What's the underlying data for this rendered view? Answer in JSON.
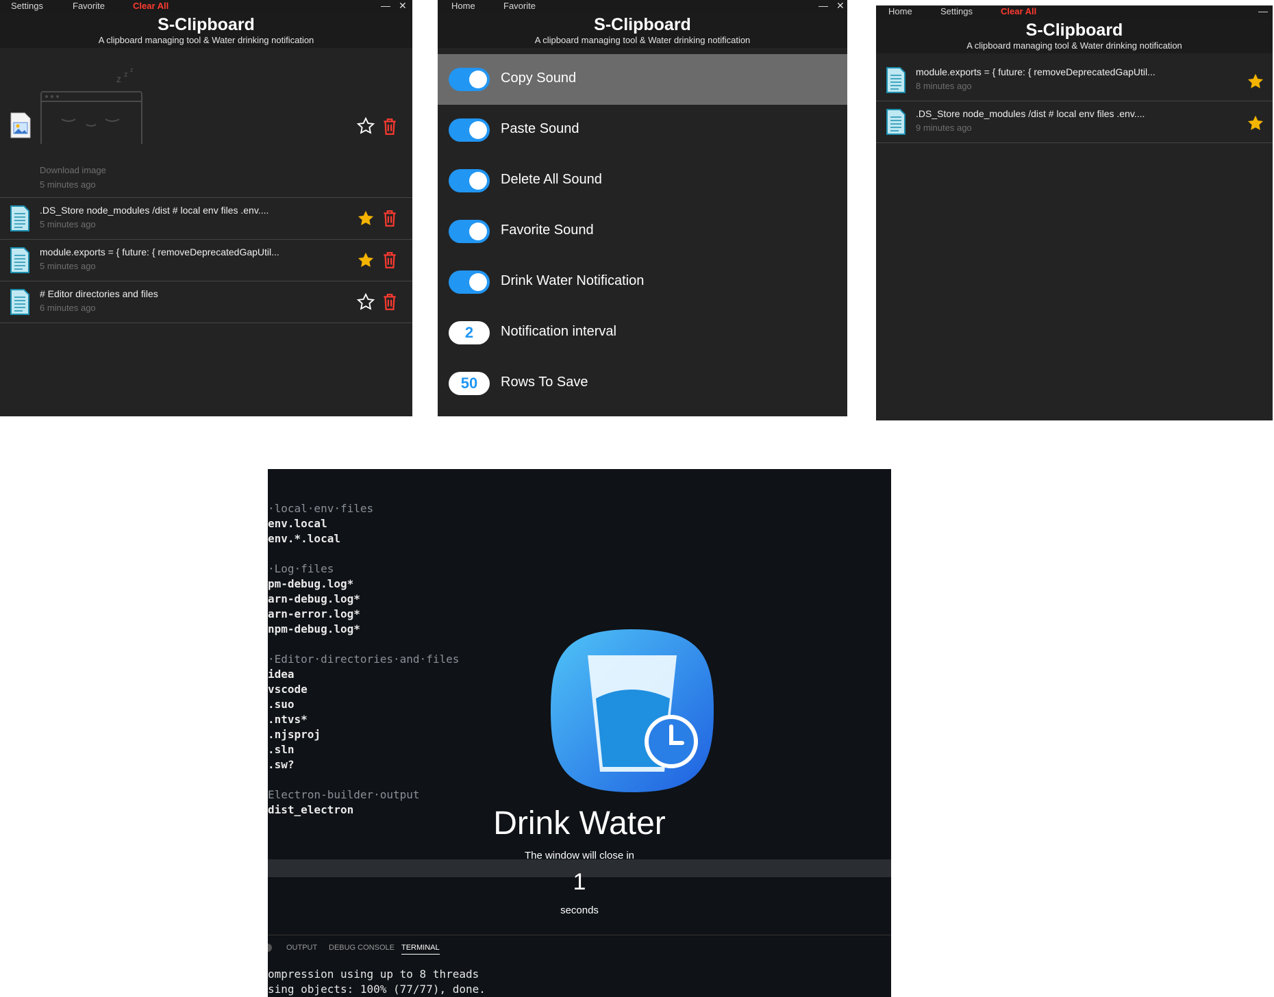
{
  "app": {
    "title": "S-Clipboard",
    "subtitle": "A clipboard managing tool & Water drinking notification",
    "accent": "#2196f3",
    "danger": "#ff3b30",
    "star_color": "#f5b400"
  },
  "window_home": {
    "menu": {
      "settings": "Settings",
      "favorite": "Favorite",
      "clear_all": "Clear All"
    },
    "minimize": "—",
    "close": "✕",
    "items": [
      {
        "kind": "image",
        "label": "Download image",
        "time": "5 minutes ago",
        "favorite": false,
        "icon": "image-file-icon"
      },
      {
        "kind": "text",
        "label": ".DS_Store node_modules /dist # local env files .env....",
        "time": "5 minutes ago",
        "favorite": true,
        "icon": "text-file-icon"
      },
      {
        "kind": "text",
        "label": "module.exports = { future: { removeDeprecatedGapUtil...",
        "time": "5 minutes ago",
        "favorite": true,
        "icon": "text-file-icon"
      },
      {
        "kind": "text",
        "label": "# Editor directories and files",
        "time": "6 minutes ago",
        "favorite": false,
        "icon": "text-file-icon"
      }
    ]
  },
  "window_settings": {
    "menu": {
      "home": "Home",
      "favorite": "Favorite"
    },
    "minimize": "—",
    "close": "✕",
    "settings": [
      {
        "label": "Copy Sound",
        "type": "toggle",
        "value": true
      },
      {
        "label": "Paste Sound",
        "type": "toggle",
        "value": true
      },
      {
        "label": "Delete All Sound",
        "type": "toggle",
        "value": true
      },
      {
        "label": "Favorite Sound",
        "type": "toggle",
        "value": true
      },
      {
        "label": "Drink Water Notification",
        "type": "toggle",
        "value": true
      },
      {
        "label": "Notification interval",
        "type": "number",
        "value": "2"
      },
      {
        "label": "Rows To Save",
        "type": "number",
        "value": "50"
      }
    ]
  },
  "window_favorite": {
    "menu": {
      "home": "Home",
      "settings": "Settings",
      "clear_all": "Clear All"
    },
    "minimize": "—",
    "items": [
      {
        "label": "module.exports = { future: { removeDeprecatedGapUtil...",
        "time": "8 minutes ago",
        "favorite": true,
        "icon": "text-file-icon"
      },
      {
        "label": ".DS_Store node_modules /dist # local env files .env....",
        "time": "9 minutes ago",
        "favorite": true,
        "icon": "text-file-icon"
      }
    ]
  },
  "notification": {
    "title": "Drink Water",
    "message": "The window will close in",
    "countdown": "1",
    "unit": "seconds",
    "editor_lines": [
      {
        "text": "·local·env·files",
        "style": "c"
      },
      {
        "text": "env.local",
        "style": "b"
      },
      {
        "text": "env.*.local",
        "style": "b"
      },
      {
        "text": "",
        "style": "b"
      },
      {
        "text": "·Log·files",
        "style": "c"
      },
      {
        "text": "pm-debug.log*",
        "style": "b"
      },
      {
        "text": "arn-debug.log*",
        "style": "b"
      },
      {
        "text": "arn-error.log*",
        "style": "b"
      },
      {
        "text": "npm-debug.log*",
        "style": "b"
      },
      {
        "text": "",
        "style": "b"
      },
      {
        "text": "·Editor·directories·and·files",
        "style": "c"
      },
      {
        "text": "idea",
        "style": "b"
      },
      {
        "text": "vscode",
        "style": "b"
      },
      {
        "text": ".suo",
        "style": "b"
      },
      {
        "text": ".ntvs*",
        "style": "b"
      },
      {
        "text": ".njsproj",
        "style": "b"
      },
      {
        "text": ".sln",
        "style": "b"
      },
      {
        "text": ".sw?",
        "style": "b"
      },
      {
        "text": "",
        "style": "b"
      },
      {
        "text": "Electron-builder·output",
        "style": "c"
      },
      {
        "text": "dist_electron",
        "style": "b"
      }
    ],
    "panel_tabs": [
      "OUTPUT",
      "DEBUG CONSOLE",
      "TERMINAL"
    ],
    "active_panel_tab": "TERMINAL",
    "terminal_lines": [
      "ompression using up to 8 threads",
      "sing objects: 100% (77/77), done."
    ]
  }
}
